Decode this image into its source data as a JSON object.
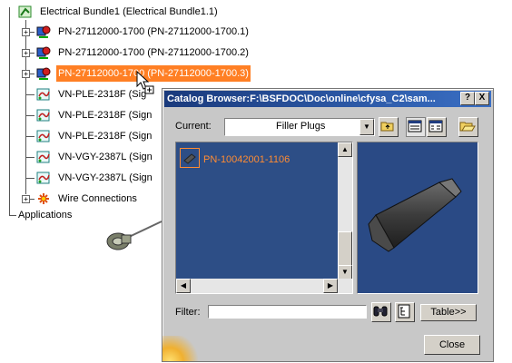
{
  "tree": {
    "root": {
      "label": "Electrical Bundle1 (Electrical Bundle1.1)"
    },
    "items": [
      {
        "label": "PN-27112000-1700 (PN-27112000-1700.1)",
        "selected": false
      },
      {
        "label": "PN-27112000-1700 (PN-27112000-1700.2)",
        "selected": false
      },
      {
        "label": "PN-27112000-1700 (PN-27112000-1700.3)",
        "selected": true
      },
      {
        "label": "VN-PLE-2318F (Sig"
      },
      {
        "label": "VN-PLE-2318F (Sign"
      },
      {
        "label": "VN-PLE-2318F (Sign"
      },
      {
        "label": "VN-VGY-2387L (Sign"
      },
      {
        "label": "VN-VGY-2387L (Sign"
      },
      {
        "label": "Wire Connections"
      }
    ],
    "applications": "Applications"
  },
  "dialog": {
    "title": "Catalog Browser:F:\\BSFDOC\\Doc\\online\\cfysa_C2\\sam...",
    "help": "?",
    "close_x": "X",
    "current_label": "Current:",
    "current_value": "Filler Plugs",
    "list_items": [
      {
        "label": "PN-10042001-1106"
      }
    ],
    "filter_label": "Filter:",
    "filter_value": "",
    "table_button": "Table>>",
    "close_button": "Close"
  },
  "colors": {
    "selection": "#ff7f24",
    "list_bg": "#2d4e86",
    "list_text": "#ff8c33",
    "titlebar": "#1a3a7c"
  }
}
